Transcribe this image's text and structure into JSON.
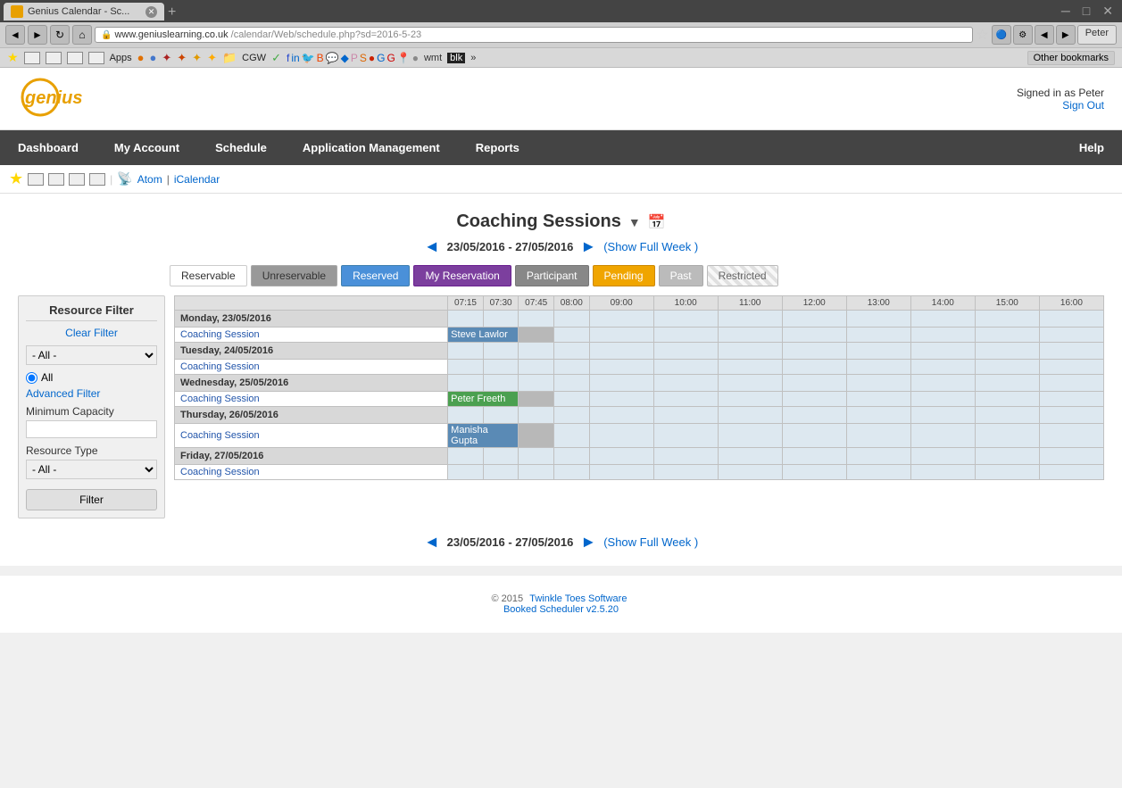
{
  "browser": {
    "tab_title": "Genius Calendar - Sc...",
    "url_domain": "www.geniuslearning.co.uk",
    "url_path": "/calendar/Web/schedule.php?sd=2016-5-23",
    "user_name": "Peter"
  },
  "bookmarks": {
    "items": [
      "Apps",
      "CGW",
      "Other bookmarks"
    ],
    "atom_link": "Atom",
    "icalendar_link": "iCalendar"
  },
  "header": {
    "logo": "genius",
    "signed_in_as": "Signed in as Peter",
    "sign_out": "Sign Out"
  },
  "nav": {
    "items": [
      "Dashboard",
      "My Account",
      "Schedule",
      "Application Management",
      "Reports"
    ],
    "help": "Help"
  },
  "page": {
    "title": "Coaching Sessions",
    "date_range": "23/05/2016 - 27/05/2016",
    "show_full_week": "(Show Full Week )",
    "legend": {
      "reservable": "Reservable",
      "unreservable": "Unreservable",
      "reserved": "Reserved",
      "my_reservation": "My Reservation",
      "participant": "Participant",
      "pending": "Pending",
      "past": "Past",
      "restricted": "Restricted"
    }
  },
  "schedule": {
    "days": [
      {
        "label": "Monday, 23/05/2016",
        "sessions": [
          {
            "name": "Coaching Session",
            "booking": "Steve Lawlor",
            "booking_type": "steve"
          }
        ]
      },
      {
        "label": "Tuesday, 24/05/2016",
        "sessions": [
          {
            "name": "Coaching Session",
            "booking": null,
            "booking_type": null
          }
        ]
      },
      {
        "label": "Wednesday, 25/05/2016",
        "sessions": [
          {
            "name": "Coaching Session",
            "booking": "Peter Freeth",
            "booking_type": "peter"
          }
        ]
      },
      {
        "label": "Thursday, 26/05/2016",
        "sessions": [
          {
            "name": "Coaching Session",
            "booking": "Manisha Gupta",
            "booking_type": "manisha"
          }
        ]
      },
      {
        "label": "Friday, 27/05/2016",
        "sessions": [
          {
            "name": "Coaching Session",
            "booking": null,
            "booking_type": null
          }
        ]
      }
    ],
    "time_headers": [
      "07:15",
      "07:30",
      "07:45",
      "08:00",
      "09:00",
      "10:00",
      "11:00",
      "12:00",
      "13:00",
      "14:00",
      "15:00",
      "16:00"
    ]
  },
  "sidebar": {
    "title": "Resource Filter",
    "clear_filter": "Clear Filter",
    "all_option": "- All -",
    "all_radio": "All",
    "advanced_filter": "Advanced Filter",
    "min_capacity_label": "Minimum Capacity",
    "resource_type_label": "Resource Type",
    "filter_button": "Filter"
  },
  "footer": {
    "copyright": "© 2015",
    "company": "Twinkle Toes Software",
    "version": "Booked Scheduler v2.5.20"
  }
}
